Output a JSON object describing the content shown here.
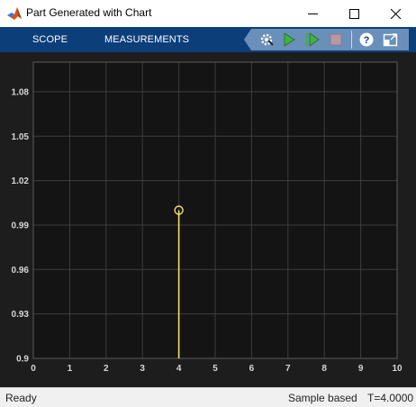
{
  "window": {
    "title": "Part Generated with Chart"
  },
  "toolstrip": {
    "tabs": [
      "SCOPE",
      "MEASUREMENTS"
    ],
    "tools": [
      "settings-icon",
      "run-icon",
      "step-forward-icon",
      "stop-icon",
      "help-icon",
      "undock-icon"
    ]
  },
  "status": {
    "left": "Ready",
    "mode": "Sample based",
    "time": "T=4.0000"
  },
  "colors": {
    "toolstrip": "#0c3e7a",
    "plot_background": "#141414",
    "grid": "#3d3d3d",
    "trace": "#f2e36b",
    "tick_text": "#d6d6d6"
  },
  "chart_data": {
    "type": "scatter",
    "style": "stem",
    "title": "",
    "xlabel": "",
    "ylabel": "",
    "xlim": [
      0,
      10
    ],
    "ylim": [
      0.9,
      1.1
    ],
    "xticks": [
      0,
      1,
      2,
      3,
      4,
      5,
      6,
      7,
      8,
      9,
      10
    ],
    "yticks": [
      0.9,
      0.93,
      0.96,
      0.99,
      1.02,
      1.05,
      1.08
    ],
    "ytick_labels": [
      "0.9",
      "0.93",
      "0.96",
      "0.99",
      "1.02",
      "1.05",
      "1.08"
    ],
    "grid": true,
    "series": [
      {
        "x": [
          4
        ],
        "y": [
          1.0
        ]
      }
    ]
  }
}
